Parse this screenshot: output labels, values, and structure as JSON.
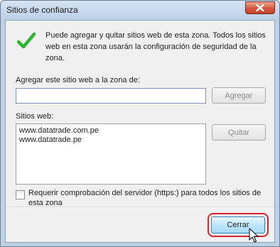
{
  "window": {
    "title": "Sitios de confianza"
  },
  "intro": {
    "text": "Puede agregar y quitar sitios web de esta zona. Todos los sitios web en esta zona usarán la configuración de seguridad de la zona."
  },
  "add_site": {
    "label": "Agregar este sitio web a la zona de:",
    "value": "",
    "button_label": "Agregar"
  },
  "sites": {
    "label": "Sitios web:",
    "items": [
      "www.datatrade.com.pe",
      "www.datatrade.pe"
    ],
    "remove_label": "Quitar"
  },
  "https_check": {
    "label": "Requerir comprobación del servidor (https:) para todos los sitios de esta zona",
    "checked": false
  },
  "footer": {
    "close_label": "Cerrar"
  },
  "icons": {
    "status": "checkmark-icon",
    "window_close": "close-icon",
    "pointer": "mouse-cursor-icon"
  },
  "colors": {
    "check_green": "#2db52d",
    "highlight_red": "#d8242e",
    "close_button": "#c44429"
  }
}
